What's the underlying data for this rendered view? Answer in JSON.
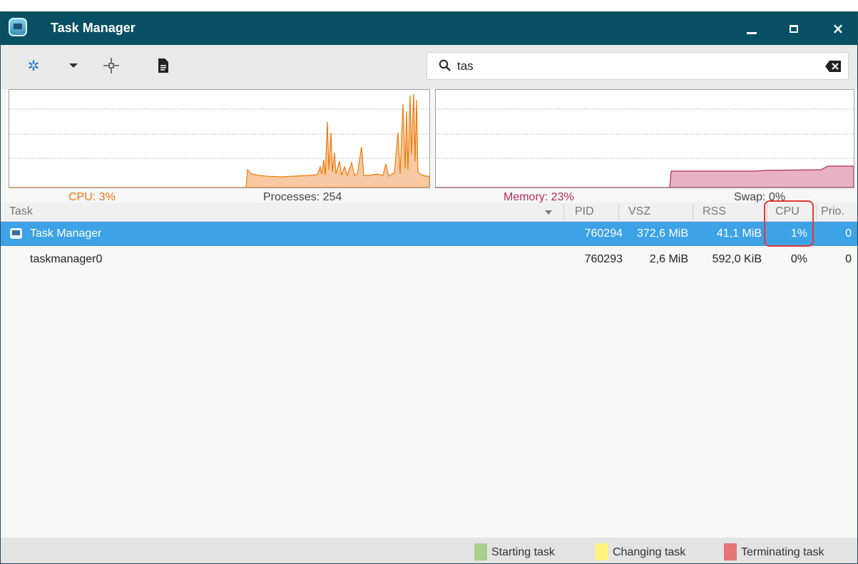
{
  "window": {
    "title": "Task Manager",
    "controls": {
      "minimize": "minimize",
      "maximize": "maximize",
      "close": "×"
    }
  },
  "toolbar": {
    "icons": [
      "gear-icon",
      "chevron-down-icon",
      "crosshair-icon",
      "document-icon"
    ],
    "search": {
      "value": "tas",
      "placeholder": ""
    }
  },
  "graphs": {
    "cpu": {
      "color": "#f07a0a",
      "fill": "#f8c9a2"
    },
    "memory": {
      "color": "#b52b5c",
      "fill": "#e8b2c4"
    }
  },
  "stats": {
    "cpu": "CPU: 3%",
    "processes": "Processes: 254",
    "memory": "Memory: 23%",
    "swap": "Swap: 0%"
  },
  "table": {
    "columns": [
      "Task",
      "PID",
      "VSZ",
      "RSS",
      "CPU",
      "Prio."
    ],
    "rows": [
      {
        "task": "Task Manager",
        "pid": "760294",
        "vsz": "372,6 MiB",
        "rss": "41,1 MiB",
        "cpu": "1%",
        "prio": "0",
        "selected": true
      },
      {
        "task": "taskmanager0",
        "pid": "760293",
        "vsz": "2,6 MiB",
        "rss": "592,0 KiB",
        "cpu": "0%",
        "prio": "0",
        "selected": false
      }
    ],
    "selected_color": "#3da2e6"
  },
  "legend": [
    {
      "label": "Starting task",
      "color": "#a8d08d"
    },
    {
      "label": "Changing task",
      "color": "#fff27a"
    },
    {
      "label": "Terminating task",
      "color": "#e57373"
    }
  ]
}
